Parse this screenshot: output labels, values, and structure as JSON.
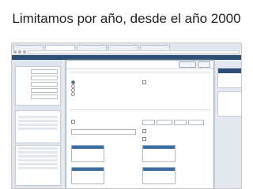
{
  "slide": {
    "title": "Limitamos por año, desde el año 2000"
  }
}
